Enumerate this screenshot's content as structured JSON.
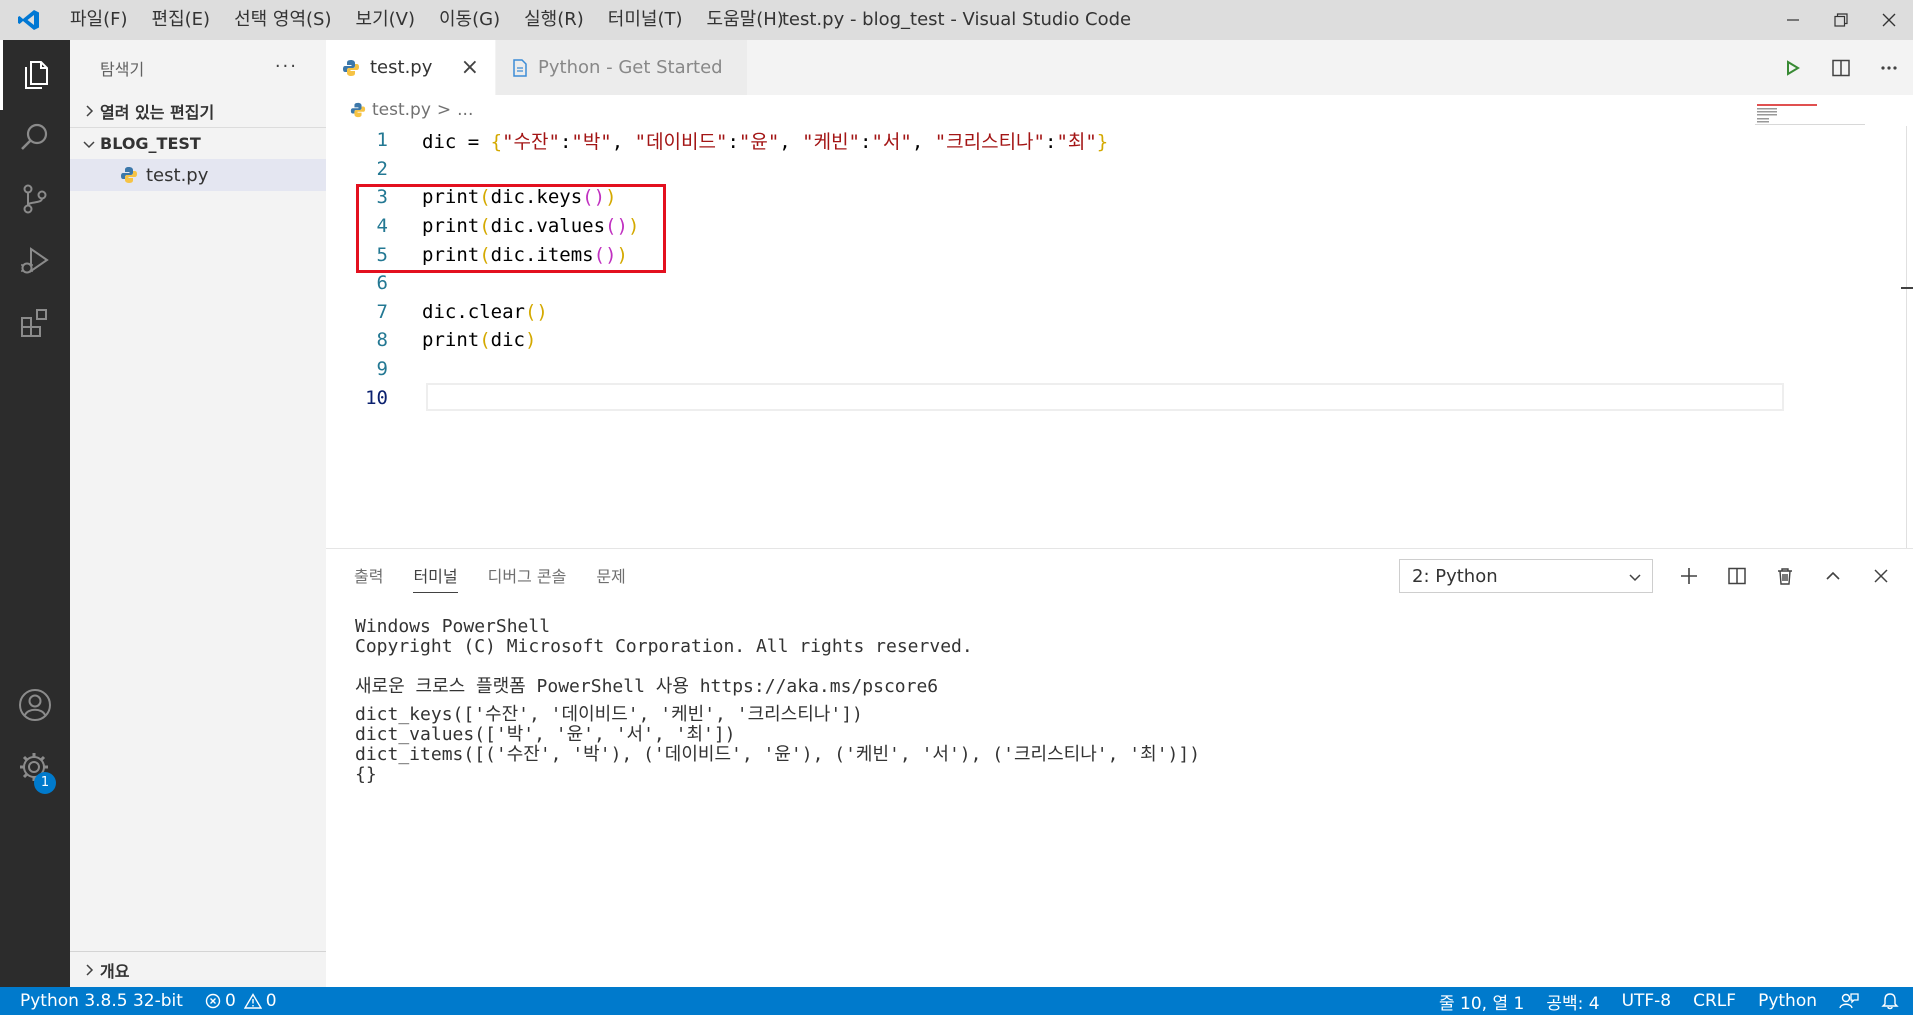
{
  "window": {
    "title": "test.py - blog_test - Visual Studio Code",
    "menu": [
      "파일(F)",
      "편집(E)",
      "선택 영역(S)",
      "보기(V)",
      "이동(G)",
      "실행(R)",
      "터미널(T)",
      "도움말(H)"
    ]
  },
  "activity": {
    "badge_count": "1"
  },
  "sidebar": {
    "title": "탐색기",
    "more": "···",
    "open_editors": "열려 있는 편집기",
    "folder": "BLOG_TEST",
    "file": "test.py",
    "outline": "개요"
  },
  "tabs": [
    {
      "label": "test.py",
      "close": "×"
    },
    {
      "label": "Python - Get Started"
    }
  ],
  "breadcrumb": {
    "file": "test.py",
    "sep": ">",
    "rest": "..."
  },
  "code": {
    "line_numbers": [
      "1",
      "2",
      "3",
      "4",
      "5",
      "6",
      "7",
      "8",
      "9",
      "10"
    ],
    "line1": {
      "a": "dic = ",
      "open": "{",
      "k1": "\"수잔\"",
      "c1": ":",
      "v1": "\"박\"",
      "sep1": ", ",
      "k2": "\"데이비드\"",
      "c2": ":",
      "v2": "\"윤\"",
      "sep2": ", ",
      "k3": "\"케빈\"",
      "c3": ":",
      "v3": "\"서\"",
      "sep3": ", ",
      "k4": "\"크리스티나\"",
      "c4": ":",
      "v4": "\"최\"",
      "close": "}"
    },
    "line3": {
      "fn": "print",
      "arg": "dic.keys"
    },
    "line4": {
      "fn": "print",
      "arg": "dic.values"
    },
    "line5": {
      "fn": "print",
      "arg": "dic.items"
    },
    "line7": {
      "expr": "dic.clear"
    },
    "line8": {
      "fn": "print",
      "arg": "dic"
    },
    "paren_open": "(",
    "paren_close": ")"
  },
  "panel": {
    "tabs": [
      "출력",
      "터미널",
      "디버그 콘솔",
      "문제"
    ],
    "active_tab": "터미널",
    "terminal_select": "2: Python",
    "terminal_lines": [
      "Windows PowerShell",
      "Copyright (C) Microsoft Corporation. All rights reserved.",
      "",
      "새로운 크로스 플랫폼 PowerShell 사용 https://aka.ms/pscore6",
      "dict_keys(['수잔', '데이비드', '케빈', '크리스티나'])",
      "dict_values(['박', '윤', '서', '최'])",
      "dict_items([('수잔', '박'), ('데이비드', '윤'), ('케빈', '서'), ('크리스티나', '최')])",
      "{}"
    ]
  },
  "statusbar": {
    "interpreter": "Python 3.8.5 32-bit",
    "errors": "0",
    "warnings": "0",
    "position": "줄 10, 열 1",
    "spaces": "공백: 4",
    "encoding": "UTF-8",
    "eol": "CRLF",
    "language": "Python"
  },
  "colors": {
    "accent": "#007acc",
    "highlight_box": "#e3101f",
    "string": "#a31515",
    "line_number": "#237893"
  }
}
